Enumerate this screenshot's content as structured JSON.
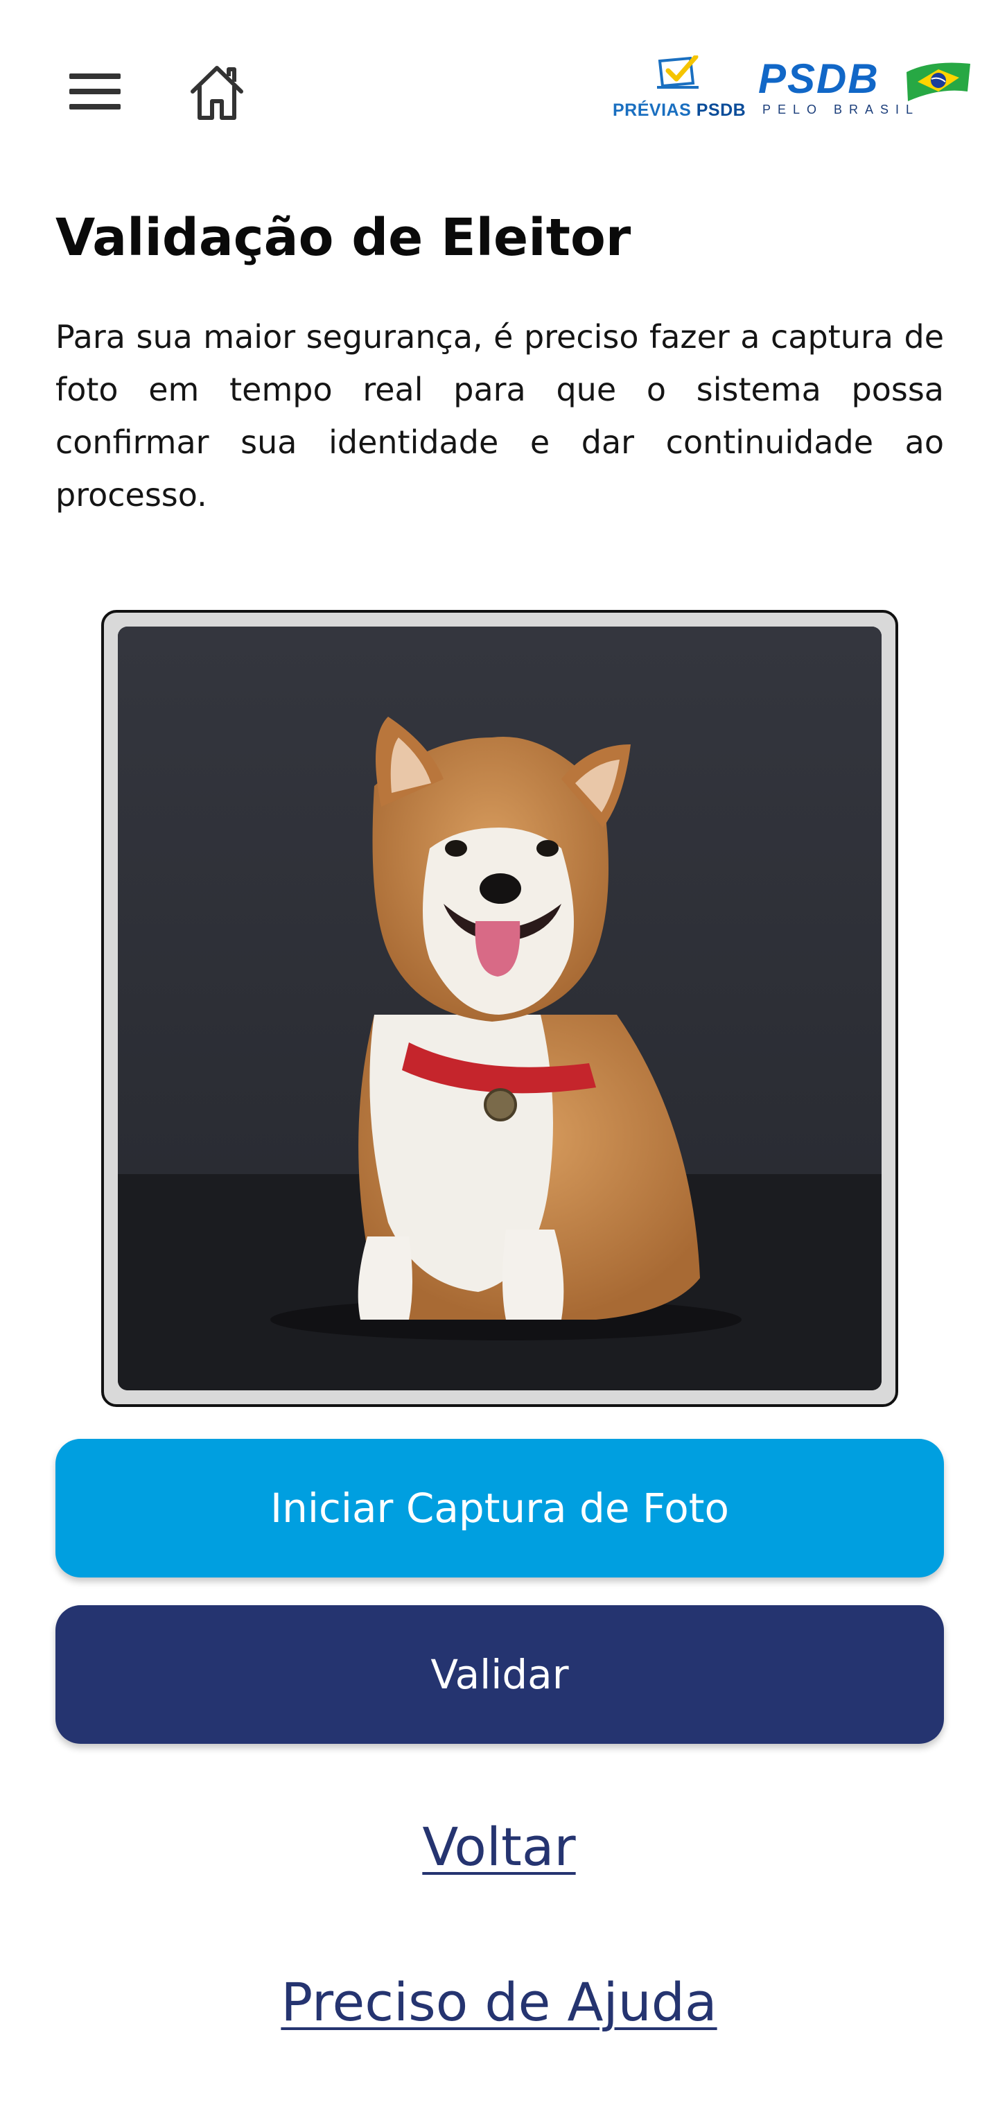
{
  "header": {
    "menu_icon": "hamburger-menu-icon",
    "home_icon": "home-icon",
    "previas_logo_text_light": "PRÉVIAS",
    "previas_logo_text_bold": "PSDB",
    "psdb_logo_text": "PSDB",
    "psdb_logo_subtitle": "PELO BRASIL"
  },
  "main": {
    "title": "Validação de Eleitor",
    "intro": "Para sua maior segurança, é preciso fazer a captura de foto em tempo real para que o sistema possa confirmar sua identidade e dar continuidade ao processo.",
    "camera_preview": "camera-preview-image"
  },
  "buttons": {
    "capture_label": "Iniciar Captura de Foto",
    "validate_label": "Validar"
  },
  "links": {
    "back_label": "Voltar",
    "help_label": "Preciso de Ajuda"
  },
  "colors": {
    "capture_button": "#009fe0",
    "validate_button": "#253470",
    "link": "#253470",
    "brand_blue": "#1167c7"
  }
}
